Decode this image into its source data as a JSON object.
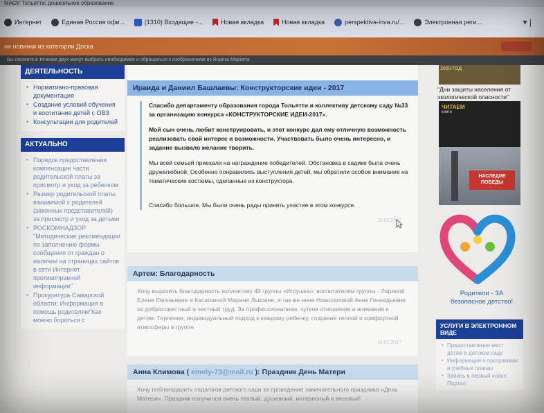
{
  "window": {
    "title": "МАОУ Тольятти: дошкольное образование"
  },
  "bookmarks": [
    {
      "label": "Интернет",
      "icon": "disc-icon"
    },
    {
      "label": "Единая Россия офи...",
      "icon": "party-icon"
    },
    {
      "label": "(1310) Входящие -...",
      "icon": "mail-icon"
    },
    {
      "label": "Новая вкладка",
      "icon": "bookmark-flag-icon"
    },
    {
      "label": "Новая вкладка",
      "icon": "bookmark-flag-icon"
    },
    {
      "label": "perspektiva-inva.ru/...",
      "icon": "globe-icon"
    },
    {
      "label": "Электронная реги...",
      "icon": "chrome-icon"
    }
  ],
  "orange_bar": {
    "text": "ни новинки из категории Доска",
    "button": ""
  },
  "ad_strip": {
    "text": "Вы сможете в течение двух минут выбрать необходимое и обращаться к изображениям из Яндекс.Маркета"
  },
  "left": {
    "activity_title": "ДЕЯТЕЛЬНОСТЬ",
    "activity_items": [
      "Нормативно-правовая документация",
      "Создание условий обучения и воспитания детей с ОВЗ",
      "Консультации для родителей"
    ],
    "actual_title": "АКТУАЛЬНО",
    "actual_items": [
      "Порядок предоставления компенсации части родительской платы за присмотр и уход за ребенком",
      "Размер родительской платы взимаемой с родителей (законных представителей) за присмотр и уход за детьми",
      "РОСКОМНАДЗОР \"Методические рекомендации по заполнению формы сообщения от граждан о наличии на страницах сайтов в сети Интернет противоправной информации\"",
      "Прокуратура Самарской области: Информация в помощь родителям\"Как можно бороться с"
    ]
  },
  "posts": [
    {
      "author": "Ираида и Даниил Башлаевы: Конструкторские идеи - 2017",
      "paragraphs": [
        "Спасибо департаменту образования города Тольятти и коллективу детскому саду №33 за организацию конкурса «КОНСТРУКТОРСКИЕ ИДЕИ-2017».",
        "Мой сын очень любит конструировать, и этот конкурс дал ему отличную возможность реализовать свой интерес и возможности. Участвовать было очень интересно, и задание вызвало желание творить.",
        "Мы всей семьей приехали на награждение победителей. Обстановка в садике была очень дружелюбной. Особенно понравились выступления детей, мы обратили особое внимание на тематические костюмы, сделанные из конструктора.",
        "Спасибо большое. Мы были очень рады принять участие в этом конкурсе."
      ],
      "date": "18.03.2017"
    },
    {
      "author": "Артем: Благодарность",
      "paragraphs": [
        "Хочу выразить благодарность коллективу 4й группы «Игрушка»: воспитателям группы - Лариной Елене Евгеньевне и Касаткиной Марине Львовне, а так же няне Новоселовой Анне Геннадьевне за добросовестный и честный труд. За профессионализм, чуткое отношение и внимание к детям. Терпение, индивидуальный подход к каждому ребенку, создание теплой и комфортной атмосферы в группе."
      ],
      "date": "16.03.2017"
    },
    {
      "author_prefix": "Анна Климова ( ",
      "author_email": "emely-73@mail.ru",
      "author_suffix": " ): Праздник День Матери",
      "paragraphs": [
        "Хочу поблагодарить педагогов детского сада за проведение замечательного праздника «День Матери». Праздник получился очень теплый, душевный, интересный и веселый!"
      ]
    }
  ],
  "right": {
    "banner1_text": "2020 ГОД",
    "day_text": "\"Дни защиты населения от экологической опасности\"",
    "banner2_text": "ЧИТАЕМ",
    "banner2_sub": "книги",
    "banner3_tag": "НАСЛЕДИЕ ПОБЕДЫ",
    "parents_title": "Родители - ЗА",
    "parents_sub": "безопасное детство!",
    "services_title": "УСЛУГИ В ЭЛЕКТРОННОМ ВИДЕ",
    "services_items": [
      "Предоставление мест детям в детском саду",
      "Информация о программах и учебных планах",
      "Запись в первый класс. Портал"
    ]
  },
  "colors": {
    "accent": "#1c3f97",
    "post_header": "#8ab3e6",
    "orange": "#c87438"
  }
}
